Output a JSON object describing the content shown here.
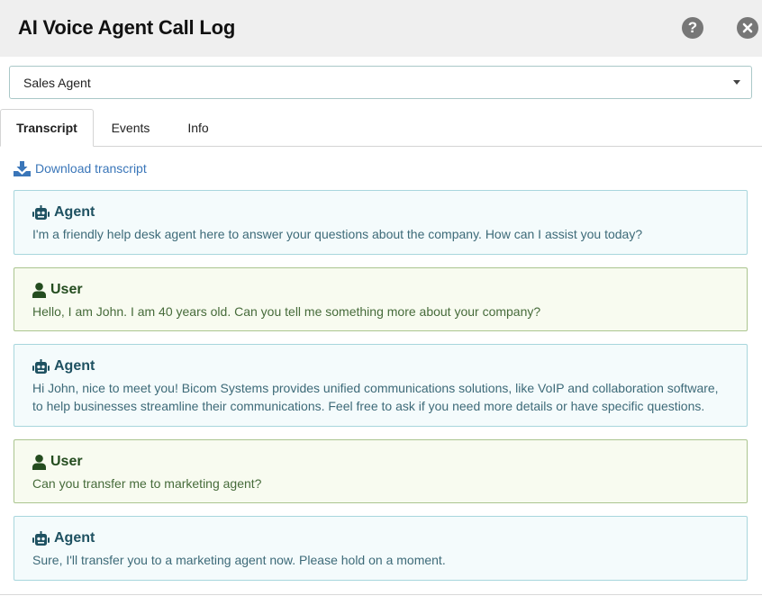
{
  "window": {
    "title": "AI Voice Agent Call Log",
    "help_icon": "question-circle",
    "close_icon": "close-circle"
  },
  "agent_select": {
    "value": "Sales Agent"
  },
  "tabs": [
    {
      "label": "Transcript",
      "active": true
    },
    {
      "label": "Events",
      "active": false
    },
    {
      "label": "Info",
      "active": false
    }
  ],
  "download": {
    "label": "Download transcript",
    "icon": "download-icon"
  },
  "colors": {
    "agent_bg": "#f4fbfc",
    "agent_border": "#a8d6dd",
    "user_bg": "#f8fbf0",
    "user_border": "#abc58f",
    "link": "#3a76b9"
  },
  "transcript": [
    {
      "role": "Agent",
      "icon": "robot-icon",
      "text": "I'm a friendly help desk agent here to answer your questions about the company. How can I assist you today?"
    },
    {
      "role": "User",
      "icon": "user-icon",
      "text": "Hello, I am John. I am 40 years old. Can you tell me something more about your company?"
    },
    {
      "role": "Agent",
      "icon": "robot-icon",
      "text": "Hi John, nice to meet you! Bicom Systems provides unified communications solutions, like VoIP and collaboration software, to help businesses streamline their communications. Feel free to ask if you need more details or have specific questions."
    },
    {
      "role": "User",
      "icon": "user-icon",
      "text": "Can you transfer me to marketing agent?"
    },
    {
      "role": "Agent",
      "icon": "robot-icon",
      "text": "Sure, I'll transfer you to a marketing agent now. Please hold on a moment."
    }
  ]
}
